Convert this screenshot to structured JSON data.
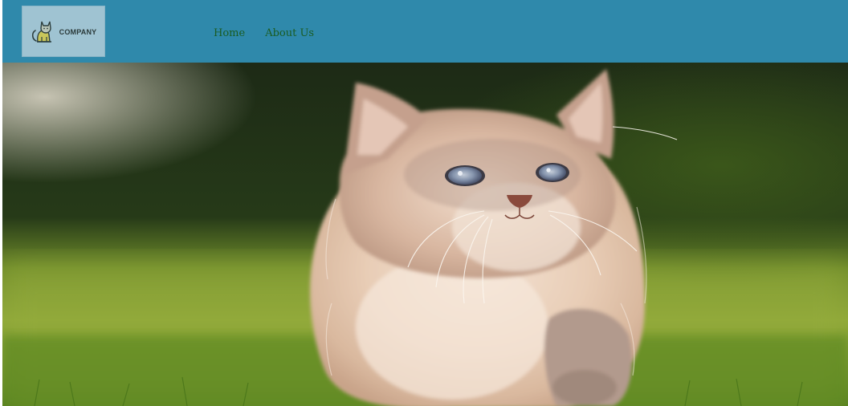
{
  "header": {
    "logo": {
      "text": "COMPANY",
      "icon": "cat-icon"
    },
    "nav": [
      {
        "label": "Home"
      },
      {
        "label": "About Us"
      }
    ],
    "background_color": "#2f89ab",
    "nav_color": "#1a5c22"
  },
  "hero": {
    "image": "kitten-photo"
  }
}
